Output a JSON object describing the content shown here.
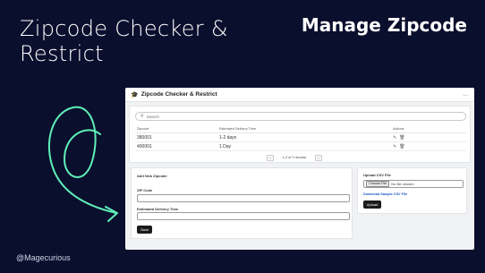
{
  "promo": {
    "title": "Zipcode Checker & Restrict",
    "heading": "Manage Zipcode",
    "handle": "@Magecurious",
    "arrow_color": "#5ff0b8"
  },
  "app": {
    "title": "Zipcode Checker & Restrict",
    "menu": "…",
    "search": {
      "placeholder": "Search"
    },
    "table": {
      "headers": {
        "zipcode": "Zipcode",
        "time": "Estimated Delivery Time",
        "actions": "Actions"
      },
      "rows": [
        {
          "zipcode": "380001",
          "time": "1-2 days"
        },
        {
          "zipcode": "400001",
          "time": "1 Day"
        }
      ],
      "pagination": "1-2 of 2 records",
      "prev": "‹",
      "next": "›"
    },
    "form": {
      "title": "Add New Zipcode",
      "zip_label": "ZIP Code",
      "time_label": "Estimated Delivery Time",
      "save_label": "Save"
    },
    "upload": {
      "title": "Upload CSV File",
      "choose_label": "Choose File",
      "file_status": "No file chosen",
      "sample_link": "Download Sample CSV File",
      "upload_label": "Upload"
    }
  }
}
